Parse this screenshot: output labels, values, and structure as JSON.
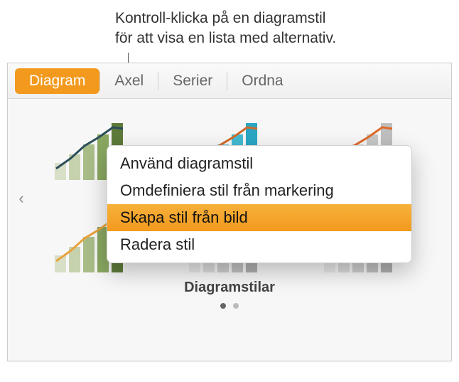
{
  "callout": {
    "line1": "Kontroll-klicka på en diagramstil",
    "line2": "för att visa en lista med alternativ."
  },
  "tabs": {
    "diagram": "Diagram",
    "axel": "Axel",
    "serier": "Serier",
    "ordna": "Ordna"
  },
  "styles": {
    "section_label": "Diagramstilar",
    "thumbs": [
      {
        "accent": "#5e7a3a",
        "line": "#2b4e5b"
      },
      {
        "accent": "#2aa7c4",
        "line": "#d06b2a"
      },
      {
        "accent": "#bfbfbf",
        "line": "#e06a2a"
      },
      {
        "accent": "#5e7a3a",
        "line": "#e8a23a"
      },
      {
        "accent": "#b0b0b0",
        "line": "#888"
      },
      {
        "accent": "#b0b0b0",
        "line": "#888"
      }
    ]
  },
  "menu": {
    "apply": "Använd diagramstil",
    "redefine": "Omdefiniera stil från markering",
    "create": "Skapa stil från bild",
    "delete": "Radera stil"
  }
}
